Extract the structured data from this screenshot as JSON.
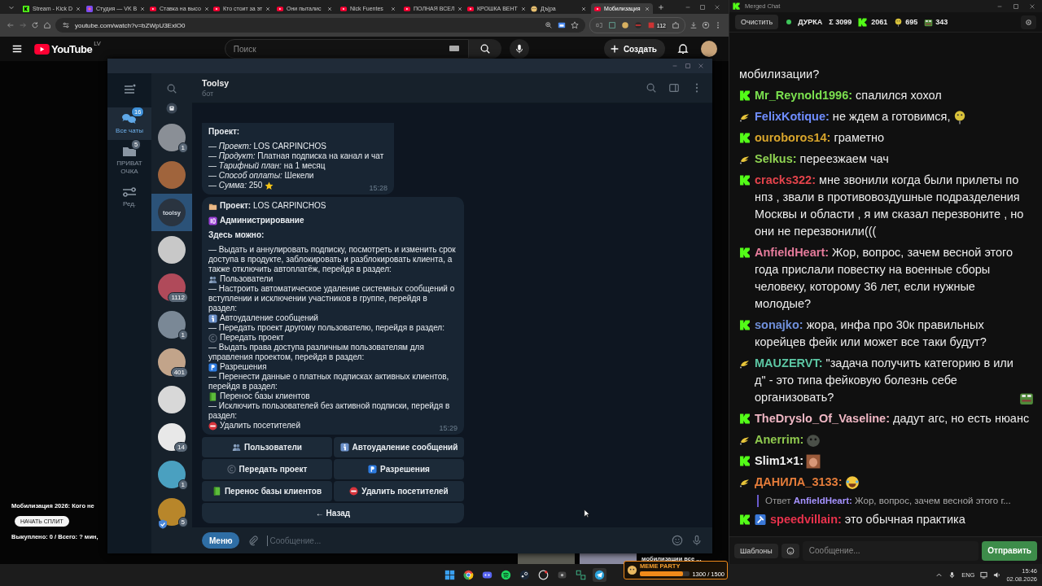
{
  "browser": {
    "tabs": [
      {
        "label": "Stream - Kick D",
        "kind": "kick",
        "selected": false
      },
      {
        "label": "Студия — VK В",
        "kind": "vk",
        "selected": false
      },
      {
        "label": "Ставка на высо",
        "kind": "youtube",
        "selected": false
      },
      {
        "label": "Кто стоит за эт",
        "kind": "youtube",
        "selected": false
      },
      {
        "label": "Они пыталис",
        "kind": "youtube",
        "selected": false
      },
      {
        "label": "Nick Fuentes",
        "kind": "youtube",
        "selected": false
      },
      {
        "label": "ПОЛНАЯ ВСЕЛ",
        "kind": "youtube",
        "selected": false
      },
      {
        "label": "КРОШКА ВЕНТ",
        "kind": "youtube",
        "selected": false
      },
      {
        "label": "Дъ|ра",
        "kind": "other",
        "selected": false
      },
      {
        "label": "Мобилизация",
        "kind": "youtube",
        "selected": true
      }
    ],
    "url": "youtube.com/watch?v=bZWpU3ExlO0",
    "extension_badge": "112"
  },
  "youtube": {
    "logo": "YouTube",
    "region": "LV",
    "search_placeholder": "Поиск",
    "create_button": "Создать"
  },
  "video_overlay": {
    "title": "Мобилизация 2026: Кого не",
    "button": "НАЧАТЬ СПЛИТ",
    "stats": "Выкуплено: 0 / Всего: ? мин,"
  },
  "recommendation": {
    "title": "мобилизации все ..."
  },
  "meme_party": {
    "title": "MEME PARTY",
    "reading": "1300 / 1500",
    "level": 0.87
  },
  "telegram": {
    "folders": [
      {
        "label": "Все чаты",
        "badge": "16",
        "kind": "chats",
        "selected": true
      },
      {
        "label": "ПРИВАТ ОЧКА",
        "badge": "5",
        "kind": "folder",
        "selected": false
      },
      {
        "label": "Ред.",
        "kind": "edit",
        "selected": false
      }
    ],
    "chats": [
      {
        "badge": "1",
        "selected": false,
        "verified": false
      },
      {
        "selected": false,
        "verified": false
      },
      {
        "avatar_text": "toolsy",
        "selected": true,
        "verified": false
      },
      {
        "selected": false,
        "verified": false
      },
      {
        "badge": "1112",
        "selected": false,
        "verified": false
      },
      {
        "badge": "1",
        "selected": false,
        "verified": false
      },
      {
        "badge": "401",
        "selected": false,
        "verified": false
      },
      {
        "selected": false,
        "verified": false
      },
      {
        "badge": "14",
        "selected": false,
        "verified": false
      },
      {
        "badge": "1",
        "selected": false,
        "verified": false
      },
      {
        "badge": "5",
        "selected": false,
        "verified": true
      }
    ],
    "chat_header": {
      "title": "Toolsy",
      "subtitle": "бот"
    },
    "summary_message": {
      "heading": "Проект:",
      "lines": [
        {
          "kind": "plain",
          "text": "— *Проект:* LOS CARPINCHOS"
        },
        {
          "kind": "plain",
          "text": "— *Продукт:* Платная подписка на канал и чат"
        },
        {
          "kind": "plain",
          "text": "— *Тарифный план:* на 1 месяц"
        },
        {
          "kind": "plain",
          "text": "— *Способ оплаты:* Шекели"
        },
        {
          "kind": "star",
          "text": "— *Сумма:* 250"
        }
      ],
      "time": "15:28"
    },
    "menu_message": {
      "title": {
        "kind": "folder",
        "text": "**Проект:** LOS CARPINCHOS"
      },
      "section": {
        "kind": "id",
        "text": "Администрирование"
      },
      "intro": "Здесь можно:",
      "items": [
        {
          "kind": "users",
          "text": "— Выдать и аннулировать подписку, посмотреть и изменить срок доступа в продукте, заблокировать и разблокировать клиента, а также отключить автоплатёж, перейдя в раздел:",
          "target": "Пользователи"
        },
        {
          "kind": "info",
          "text": "— Настроить автоматическое удаление системных сообщений о вступлении и исключении участников в группе, перейдя в раздел:",
          "target": "Автоудаление сообщений"
        },
        {
          "kind": "copyright",
          "text": "— Передать проект другому пользователю, перейдя в раздел:",
          "target": "Передать проект"
        },
        {
          "kind": "parking",
          "text": "— Выдать права доступа различным пользователям для управления проектом, перейдя в раздел:",
          "target": "Разрешения"
        },
        {
          "kind": "book",
          "text": "— Перенести данные о платных подписках активных клиентов, перейдя в раздел:",
          "target": "Перенос базы клиентов"
        },
        {
          "kind": "no-entry",
          "text": "— Исключить пользователей без активной подписки, перейдя в раздел:",
          "target": "Удалить посетителей"
        }
      ],
      "time": "15:29"
    },
    "keyboard": [
      {
        "kind": "users",
        "label": "Пользователи"
      },
      {
        "kind": "info",
        "label": "Автоудаление сообщений"
      },
      {
        "kind": "copyright",
        "label": "Передать проект"
      },
      {
        "kind": "parking",
        "label": "Разрешения"
      },
      {
        "kind": "book",
        "label": "Перенос базы клиентов"
      },
      {
        "kind": "no-entry",
        "label": "Удалить посетителей"
      }
    ],
    "back_button": "← Назад",
    "composer": {
      "menu_button": "Меню",
      "placeholder": "Сообщение..."
    }
  },
  "merged_chat": {
    "title": "Merged Chat",
    "clear_button": "Очистить",
    "live": true,
    "channel": "ДУРКА",
    "total": "Σ 3099",
    "counts": [
      {
        "kind": "kick",
        "value": "2061"
      },
      {
        "kind": "smiley",
        "value": "695"
      },
      {
        "kind": "frog",
        "value": "343"
      }
    ],
    "messages": [
      {
        "kind": "continuation",
        "text": "мобилизации?"
      },
      {
        "kind": "kick",
        "author": "Mr_Reynold1996:",
        "color": "#7be04f",
        "text": "спалился хохол"
      },
      {
        "kind": "other",
        "author": "FelixKotique:",
        "color": "#6f8dff",
        "text": "не ждем а готовимся,",
        "emotes": [
          {
            "kind": "smiley"
          }
        ]
      },
      {
        "kind": "kick",
        "author": "ouroboros14:",
        "color": "#d8a52c",
        "text": "граметно"
      },
      {
        "kind": "other",
        "author": "Selkus:",
        "color": "#8fd352",
        "text": "переезжаем чач"
      },
      {
        "kind": "kick",
        "author": "cracks322:",
        "color": "#e2434b",
        "text": "мне звонили когда были прилеты по нпз , звали в противовоздушные подразделения Москвы и области , я им сказал перезвоните , но они не перезвонили((("
      },
      {
        "kind": "kick",
        "author": "AnfieldHeart:",
        "color": "#e57b9b",
        "text": "Жор, вопрос, зачем весной этого года прислали повестку на военные сборы человеку, которому 36 лет, если нужные молодые?"
      },
      {
        "kind": "kick",
        "author": "sonajko:",
        "color": "#6f8fd9",
        "text": "жора, инфа про 30к правильных корейцев фейк или может все таки будут?"
      },
      {
        "kind": "other",
        "author": "MAUZERVT:",
        "color": "#5cc6a3",
        "text": "\"задача получить категорию в или д\" - это типа фейковую болезнь себе организовать?",
        "emotes": [
          {
            "kind": "frog"
          }
        ]
      },
      {
        "kind": "kick",
        "author": "TheDryslo_Of_Vaseline:",
        "color": "#f0b7c4",
        "text": "дадут агс, но есть нюанс"
      },
      {
        "kind": "other",
        "author": "Anerrim:",
        "color": "#8fc94e",
        "emotes": [
          {
            "kind": "seal"
          }
        ]
      },
      {
        "kind": "kick",
        "author": "Slim1×1:",
        "color": "#f2f2f2",
        "emotes": [
          {
            "kind": "photo"
          }
        ]
      },
      {
        "kind": "other",
        "author": "ДАНИЛА_3133:",
        "color": "#e47c3a",
        "emotes": [
          {
            "kind": "laugh"
          }
        ]
      },
      {
        "kind": "reply",
        "prefix": "Ответ",
        "author": "AnfieldHeart:",
        "color": "#a592ff",
        "text": "Жор, вопрос, зачем весной этого г..."
      },
      {
        "kind": "kick",
        "author": "speedvillain:",
        "color": "#e8324c",
        "text": "это обычная практика",
        "badges": [
          {
            "kind": "moderator"
          }
        ]
      }
    ],
    "composer": {
      "templates_button": "Шаблоны",
      "placeholder": "Сообщение...",
      "send_button": "Отправить"
    }
  },
  "taskbar": {
    "language": "ENG",
    "time": "15:46",
    "date": "02.08.2026"
  }
}
